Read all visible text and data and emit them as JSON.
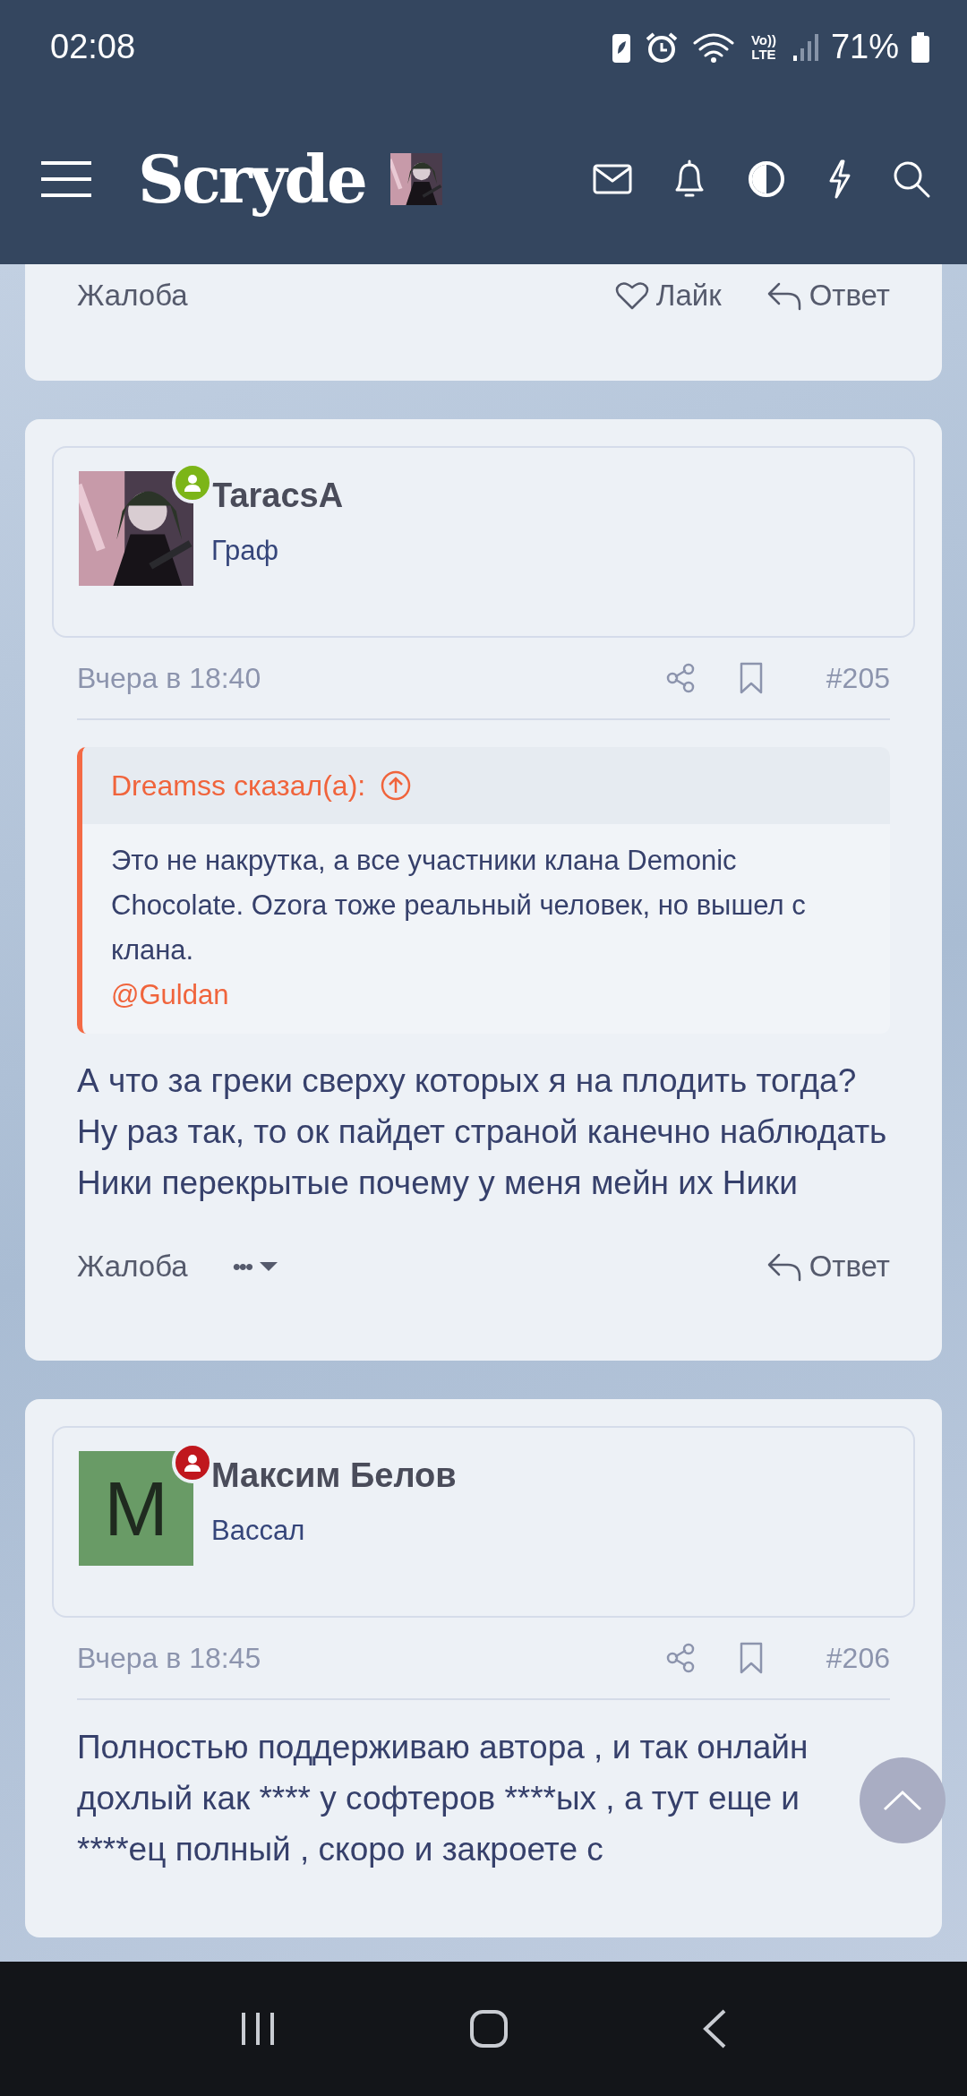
{
  "status_bar": {
    "time": "02:08",
    "volte": "Vo))",
    "network": "LTE",
    "battery": "71%"
  },
  "header": {
    "logo": "Scryde"
  },
  "posts": [
    {
      "actions": [
        {
          "kind": "report",
          "label": "Жалоба"
        },
        {
          "kind": "like",
          "label": "Лайк"
        },
        {
          "kind": "reply",
          "label": "Ответ"
        }
      ]
    },
    {
      "author": {
        "name": "TaracsA",
        "title": "Граф",
        "color": "#7cb518"
      },
      "date": "Вчера в 18:40",
      "number": "#205",
      "quote": {
        "source": "Dreamss сказал(а):",
        "text": "Это не накрутка, а все участники клана Demonic Chocolate. Ozora тоже реальный человек, но вышел с клана.",
        "mention": "@Guldan"
      },
      "body": [
        "А что за греки сверху которых я на плодить тогда?",
        "Ну раз так, то ок пайдет страной канечно наблюдать Ники перекрытые почему у меня мейн их Ники"
      ],
      "actions": [
        {
          "kind": "report",
          "label": "Жалоба"
        },
        {
          "kind": "more",
          "label": "•••"
        },
        {
          "kind": "reply",
          "label": "Ответ"
        }
      ]
    },
    {
      "author": {
        "name": "Максим Белов",
        "title": "Вассал",
        "color": "#c0171d",
        "avatar": {
          "kind": "letter",
          "letter": "M"
        }
      },
      "date": "Вчера в 18:45",
      "number": "#206",
      "body": [
        "Полностью поддерживаю автора , и так онлайн дохлый как **** у софтеров ****ых , а тут еще и ****ец полный , скоро и закроете с"
      ]
    }
  ]
}
